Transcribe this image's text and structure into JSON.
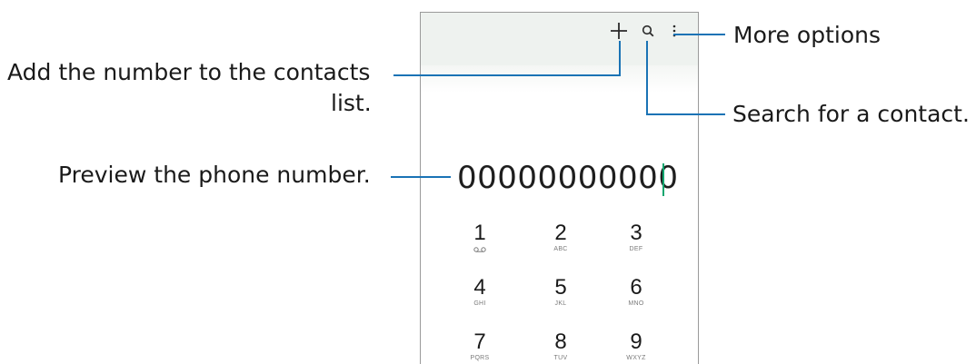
{
  "annotations": {
    "add_contact": "Add the number to the contacts list.",
    "add_contact_line1": "Add the number to the contacts",
    "add_contact_line2": "list.",
    "preview": "Preview the phone number.",
    "more_options": "More options",
    "search": "Search for a contact."
  },
  "dialer": {
    "number": "00000000000",
    "keys": [
      {
        "digit": "1",
        "letters": ""
      },
      {
        "digit": "2",
        "letters": "ABC"
      },
      {
        "digit": "3",
        "letters": "DEF"
      },
      {
        "digit": "4",
        "letters": "GHI"
      },
      {
        "digit": "5",
        "letters": "JKL"
      },
      {
        "digit": "6",
        "letters": "MNO"
      },
      {
        "digit": "7",
        "letters": "PQRS"
      },
      {
        "digit": "8",
        "letters": "TUV"
      },
      {
        "digit": "9",
        "letters": "WXYZ"
      }
    ]
  },
  "icons": {
    "add": "plus-icon",
    "search": "search-icon",
    "more": "more-vertical-icon",
    "voicemail": "voicemail-icon"
  },
  "colors": {
    "leader_line": "#1a73b5",
    "caret": "#11a66f",
    "appbar": "#eef2ef"
  }
}
